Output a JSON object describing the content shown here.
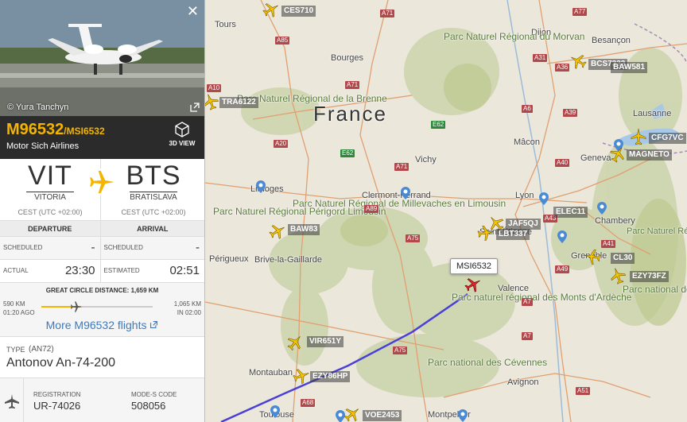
{
  "photo": {
    "credit": "© Yura Tanchyn"
  },
  "flight": {
    "registration": "M96532",
    "callsign": "/MSI6532",
    "airline": "Motor Sich Airlines",
    "view3d_label": "3D VIEW"
  },
  "origin": {
    "code": "VIT",
    "name": "VITORIA",
    "tz": "CEST (UTC +02:00)"
  },
  "destination": {
    "code": "BTS",
    "name": "BRATISLAVA",
    "tz": "CEST (UTC +02:00)"
  },
  "times": {
    "departure_header": "DEPARTURE",
    "arrival_header": "ARRIVAL",
    "scheduled_label": "SCHEDULED",
    "dep_scheduled": "-",
    "arr_scheduled": "-",
    "actual_label": "ACTUAL",
    "dep_actual": "23:30",
    "estimated_label": "ESTIMATED",
    "arr_estimated": "02:51"
  },
  "distance": {
    "title": "GREAT CIRCLE DISTANCE: 1,659 KM",
    "flown": "590 KM",
    "flown_ago": "01:20 AGO",
    "remaining": "1,065 KM",
    "remaining_in": "IN 02:00",
    "progress": 0.36,
    "more_link": "More M96532 flights"
  },
  "aircraft": {
    "type_label": "TYPE",
    "type_code": "(AN72)",
    "type_name": "Antonov An-74-200",
    "registration_label": "REGISTRATION",
    "registration": "UR-74026",
    "modes_label": "MODE-S CODE",
    "modes": "508056"
  },
  "map": {
    "country": "France",
    "selected_label": "MSI6532",
    "colors": {
      "track": "#4a3fd6",
      "plane": "#f4c400",
      "selected_plane": "#d8272e",
      "pin": "#4a8ad4"
    },
    "cities": [
      "Tours",
      "Bourges",
      "Dijon",
      "Besançon",
      "Lausanne",
      "Mâcon",
      "Geneva",
      "Vichy",
      "Clermont-Ferrand",
      "Lyon",
      "Limoges",
      "Saint-Étienne",
      "Périgueux",
      "Brive-la-Gaillarde",
      "Grenoble",
      "Chambery",
      "Valence",
      "Montauban",
      "Toulouse",
      "Avignon",
      "Montpellier"
    ],
    "parks": [
      "Parc Naturel Régional du Morvan",
      "Parc Naturel Régional de la Brenne",
      "Parc Naturel Régional de Millevaches en Limousin",
      "Parc Naturel Régional Périgord Limousin",
      "Parc naturel régional des Monts d'Ardèche",
      "Parc national des Cévennes",
      "Parc national des Ecrins",
      "Parc Naturel Régional de Chartreuse"
    ],
    "roads": [
      "A71",
      "A85",
      "A77",
      "A6",
      "A31",
      "A36",
      "A39",
      "A10",
      "A71",
      "E62",
      "A20",
      "E62",
      "A71",
      "A89",
      "A75",
      "A43",
      "A40",
      "A41",
      "A49",
      "A7",
      "A75",
      "A68",
      "A51",
      "A7"
    ],
    "aircraft": [
      "CES710",
      "TRA6122",
      "BCS7332",
      "BAW581",
      "CFG7VC",
      "MAGNETO",
      "BAW83",
      "JAF5QJ",
      "LBT337",
      "ELEC11",
      "CL30",
      "EZY73FZ",
      "VIR651Y",
      "EZY86HP",
      "VOE2453"
    ]
  }
}
